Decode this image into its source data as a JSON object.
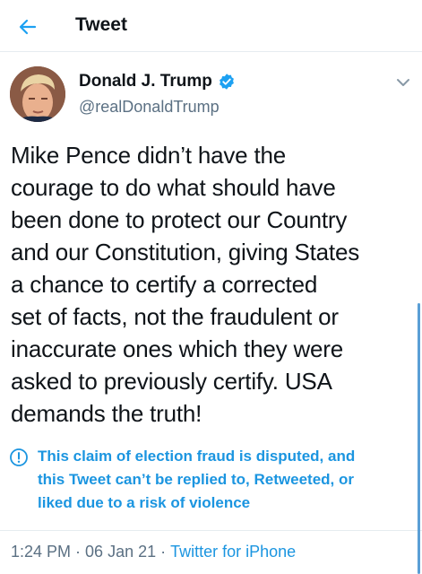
{
  "header": {
    "title": "Tweet",
    "back_icon": "arrow-left-icon",
    "accent": "#1da1f2"
  },
  "tweet": {
    "author": {
      "name": "Donald J. Trump",
      "handle": "@realDonaldTrump",
      "verified_icon": "verified-badge-icon"
    },
    "text_lines": [
      "Mike Pence didn’t have the",
      "courage to do what should have",
      "been done to protect our Country",
      "and our Constitution, giving States",
      "a chance to certify a corrected",
      "set of facts, not the fraudulent or",
      "inaccurate ones which they were",
      "asked to previously certify. USA",
      "demands the truth!"
    ],
    "notice": {
      "icon": "exclamation-circle-icon",
      "lines": [
        "This claim of election fraud is disputed, and",
        "this Tweet can’t be replied to, Retweeted, or",
        "liked due to a risk of violence"
      ],
      "color": "#1b95e0"
    },
    "meta": {
      "time": "1:24 PM",
      "date": "06 Jan 21",
      "separator": "·",
      "source": "Twitter for iPhone"
    }
  },
  "colors": {
    "text": "#0f1419",
    "secondary": "#5b7083",
    "link": "#1b95e0",
    "divider": "#e6ecf0"
  }
}
